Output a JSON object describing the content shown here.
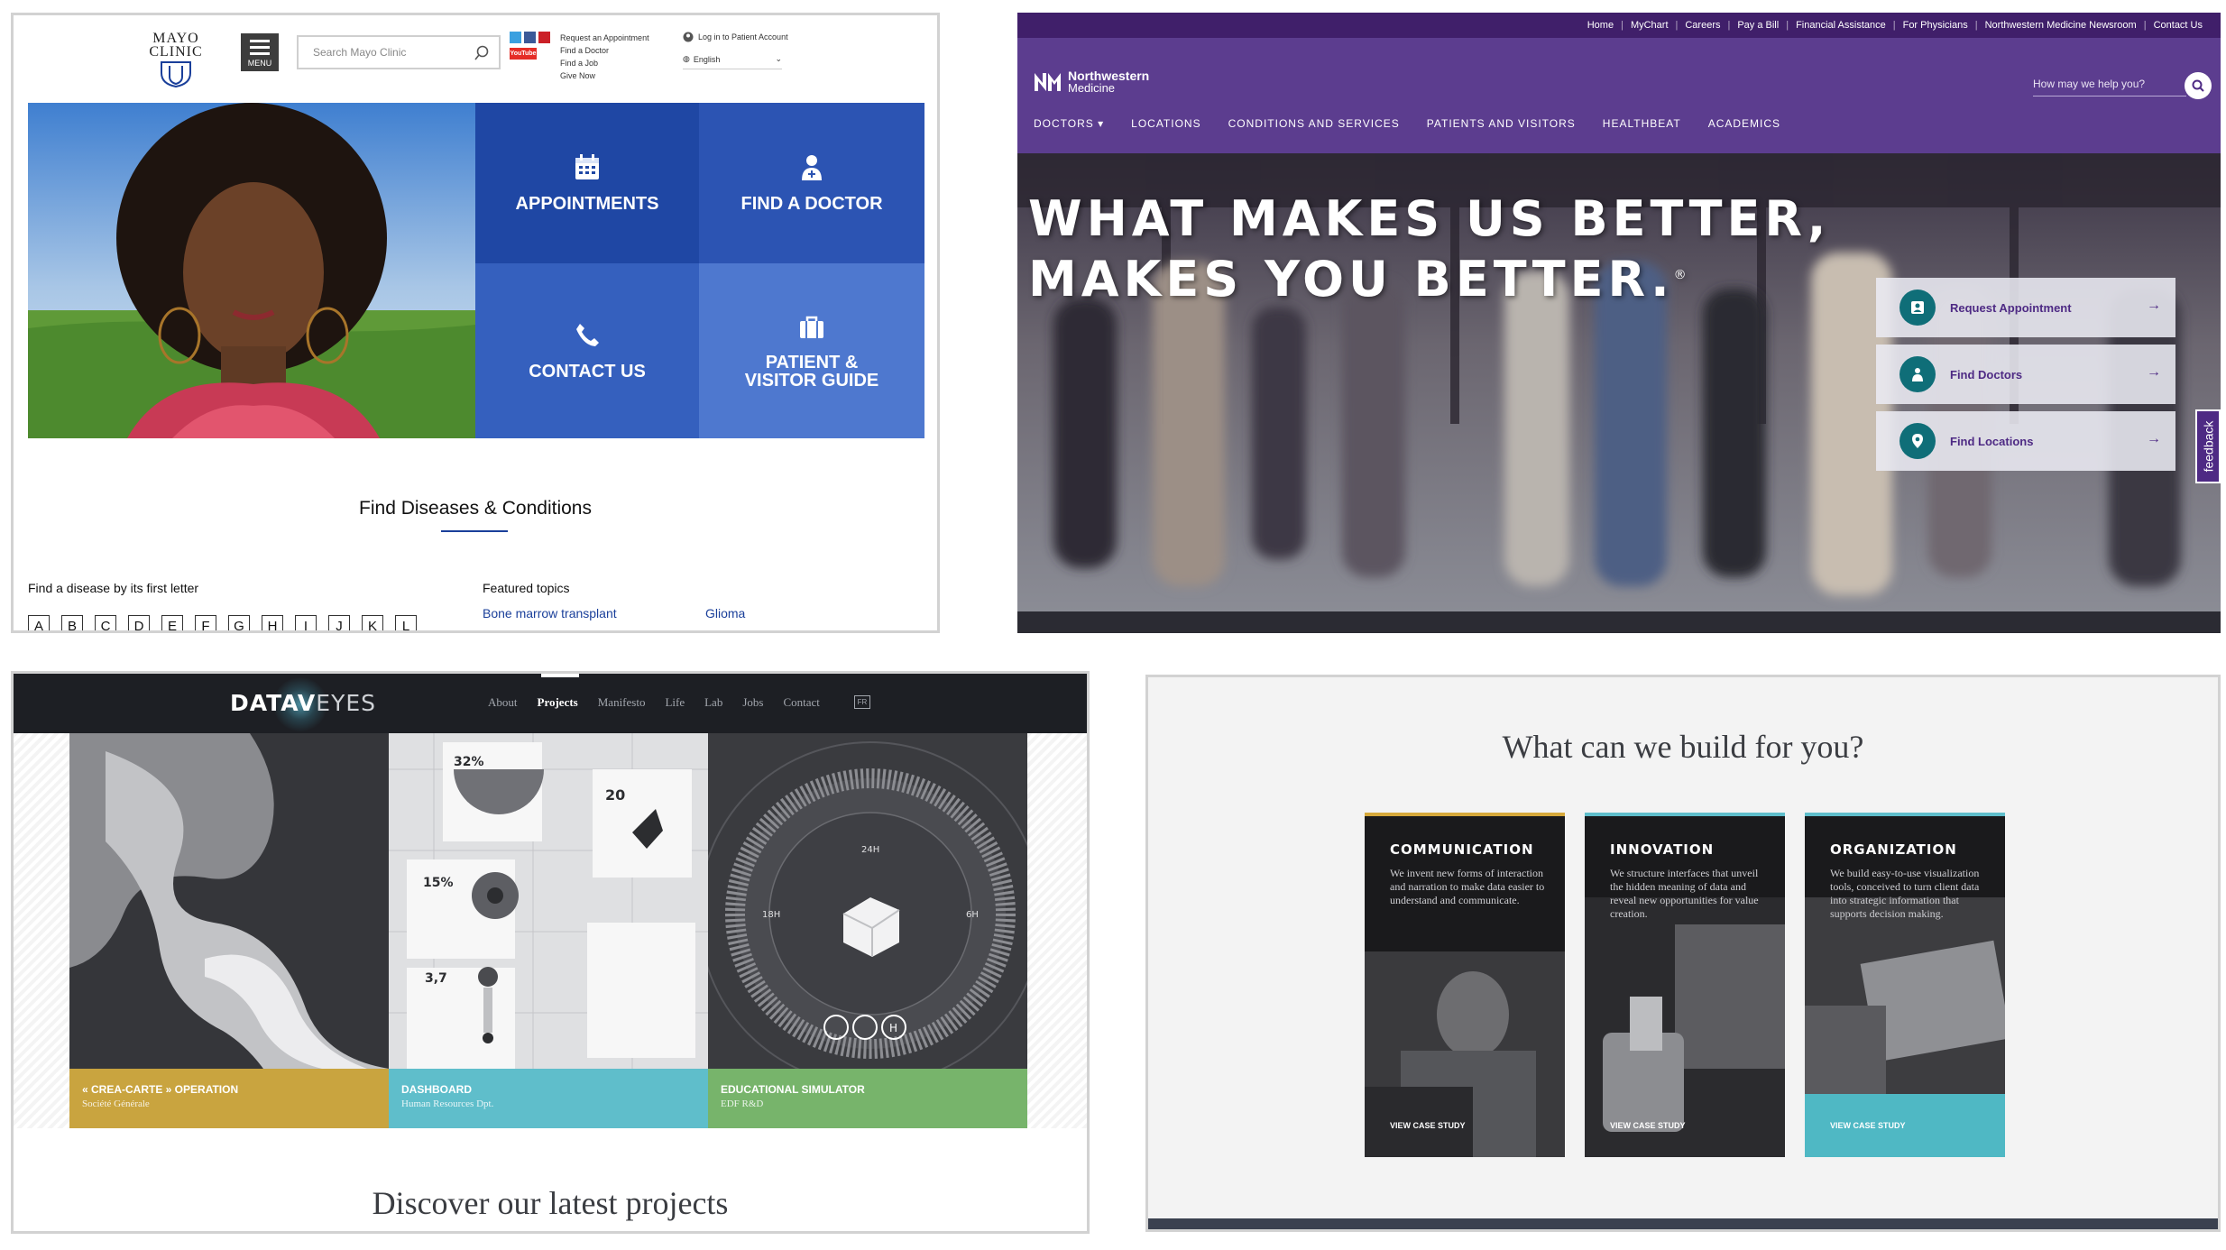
{
  "mayo": {
    "logo": [
      "MAYO",
      "CLINIC"
    ],
    "menu_label": "MENU",
    "search_placeholder": "Search Mayo Clinic",
    "social_icons": [
      "twitter-icon",
      "facebook-icon",
      "pinterest-icon",
      "youtube-icon"
    ],
    "youtube_label": "YouTube",
    "top_links": [
      "Request an Appointment",
      "Find a Doctor",
      "Find a Job",
      "Give Now"
    ],
    "account_label": "Log in to Patient Account",
    "language": "English",
    "tiles": [
      {
        "label": "APPOINTMENTS",
        "icon": "calendar-icon"
      },
      {
        "label": "FIND A DOCTOR",
        "icon": "doctor-icon"
      },
      {
        "label": "CONTACT US",
        "icon": "phone-icon"
      },
      {
        "label": "PATIENT & VISITOR GUIDE",
        "icon": "briefcase-icon"
      }
    ],
    "tile_colors": [
      "#1f47a4",
      "#2c54b3",
      "#3560be",
      "#4e78cf"
    ],
    "section_title": "Find Diseases & Conditions",
    "letter_prompt": "Find a disease by its first letter",
    "letters": [
      "A",
      "B",
      "C",
      "D",
      "E",
      "F",
      "G",
      "H",
      "I",
      "J",
      "K",
      "L"
    ],
    "featured_title": "Featured topics",
    "featured_links": [
      "Bone marrow transplant",
      "Glioma"
    ]
  },
  "northwestern": {
    "utility_links": [
      "Home",
      "MyChart",
      "Careers",
      "Pay a Bill",
      "Financial Assistance",
      "For Physicians",
      "Northwestern Medicine Newsroom",
      "Contact Us"
    ],
    "logo_lines": [
      "Northwestern",
      "Medicine"
    ],
    "search_placeholder": "How may we help you?",
    "nav": [
      "DOCTORS ▾",
      "LOCATIONS",
      "CONDITIONS AND SERVICES",
      "PATIENTS AND VISITORS",
      "HEALTHBEAT",
      "ACADEMICS"
    ],
    "headline": [
      "WHAT MAKES US BETTER,",
      "MAKES YOU BETTER."
    ],
    "headline_mark": "®",
    "cards": [
      {
        "label": "Request Appointment",
        "icon": "person-badge-icon"
      },
      {
        "label": "Find Doctors",
        "icon": "doctors-icon"
      },
      {
        "label": "Find Locations",
        "icon": "location-pin-icon"
      }
    ],
    "feedback": "feedback",
    "brand_color": "#4e2a84"
  },
  "dataveyes": {
    "logo_a": "DATAV",
    "logo_b": "EYES",
    "nav": [
      "About",
      "Projects",
      "Manifesto",
      "Life",
      "Lab",
      "Jobs",
      "Contact"
    ],
    "active_nav": "Projects",
    "lang": "FR",
    "projects": [
      {
        "title": "« CREA-CARTE » OPERATION",
        "client": "Société Générale",
        "color": "#c9a43f"
      },
      {
        "title": "DASHBOARD",
        "client": "Human Resources Dpt.",
        "color": "#5fbecb"
      },
      {
        "title": "EDUCATIONAL SIMULATOR",
        "client": "EDF R&D",
        "color": "#77b46b"
      }
    ],
    "dashboard_values": [
      "32%",
      "20",
      "15%",
      "3,7"
    ],
    "simulator_labels": [
      "24H",
      "18H",
      "6H",
      "H"
    ],
    "tagline": "Discover our latest projects"
  },
  "build": {
    "title": "What can we build for you?",
    "cards": [
      {
        "title": "COMMUNICATION",
        "text": "We invent new forms of interaction and narration to make data easier to understand and communicate.",
        "cta": "VIEW CASE STUDY"
      },
      {
        "title": "INNOVATION",
        "text": "We structure interfaces that unveil the hidden meaning of data and reveal new opportunities for value creation.",
        "cta": "VIEW CASE STUDY"
      },
      {
        "title": "ORGANIZATION",
        "text": "We build easy-to-use visualization tools, conceived to turn client data into strategic information that supports decision making.",
        "cta": "VIEW CASE STUDY"
      }
    ],
    "card_accent_colors": [
      "#d6a93b",
      "#5fbecb",
      "#5fbecb"
    ],
    "cta_band_color": "#4fb8c4"
  }
}
